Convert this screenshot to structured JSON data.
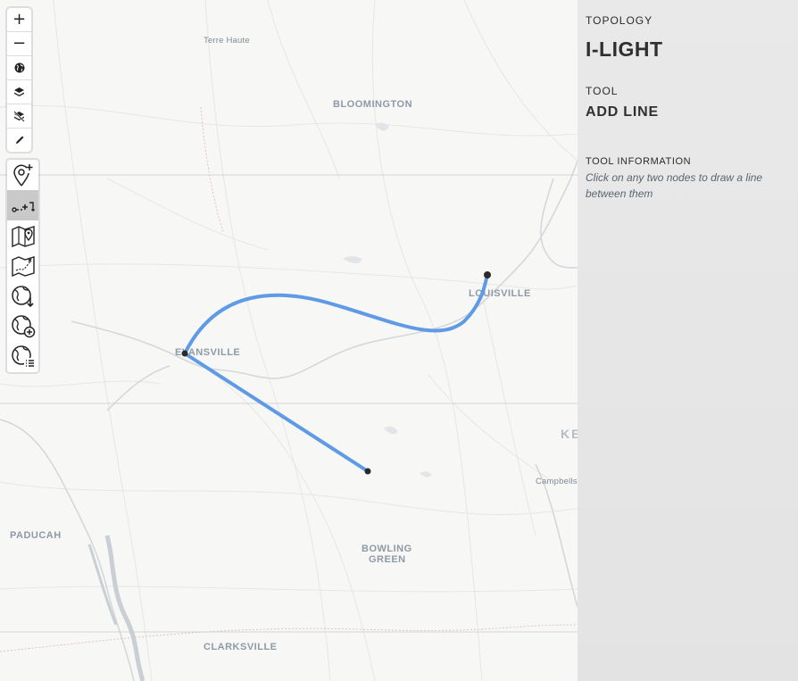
{
  "map": {
    "cities": [
      {
        "id": "terre-haute",
        "label": "Terre Haute"
      },
      {
        "id": "bloomington",
        "label": "BLOOMINGTON"
      },
      {
        "id": "louisville",
        "label": "LOUISVILLE"
      },
      {
        "id": "evansville",
        "label": "EVANSVILLE"
      },
      {
        "id": "paducah",
        "label": "PADUCAH"
      },
      {
        "id": "bowling-green-1",
        "label": "BOWLING"
      },
      {
        "id": "bowling-green-2",
        "label": "GREEN"
      },
      {
        "id": "clarksville",
        "label": "CLARKSVILLE"
      },
      {
        "id": "campbellsville",
        "label": "Campbells"
      },
      {
        "id": "ky-partial",
        "label": "KE"
      }
    ],
    "line_color": "#5f9ae6",
    "node_color": "#2a2a2a"
  },
  "controls": {
    "zoom_in_label": "+",
    "zoom_out_label": "−",
    "zoom_in_icon": "plus-icon",
    "zoom_out_icon": "minus-icon",
    "globe_icon": "globe-icon",
    "layers_icon": "layers-icon",
    "layers_off_icon": "layers-off-icon",
    "pencil_icon": "pencil-icon"
  },
  "tools": [
    {
      "icon": "add-node-icon",
      "active": false
    },
    {
      "icon": "add-line-icon",
      "active": true
    },
    {
      "icon": "map-marker-icon",
      "active": false
    },
    {
      "icon": "map-route-icon",
      "active": false
    },
    {
      "icon": "globe-download-icon",
      "active": false
    },
    {
      "icon": "globe-add-icon",
      "active": false
    },
    {
      "icon": "globe-list-icon",
      "active": false
    }
  ],
  "panel": {
    "topology_label": "TOPOLOGY",
    "topology_value": "I-LIGHT",
    "tool_label": "TOOL",
    "tool_value": "ADD LINE",
    "info_label": "TOOL INFORMATION",
    "info_text": "Click on any two nodes to draw a line between them"
  }
}
